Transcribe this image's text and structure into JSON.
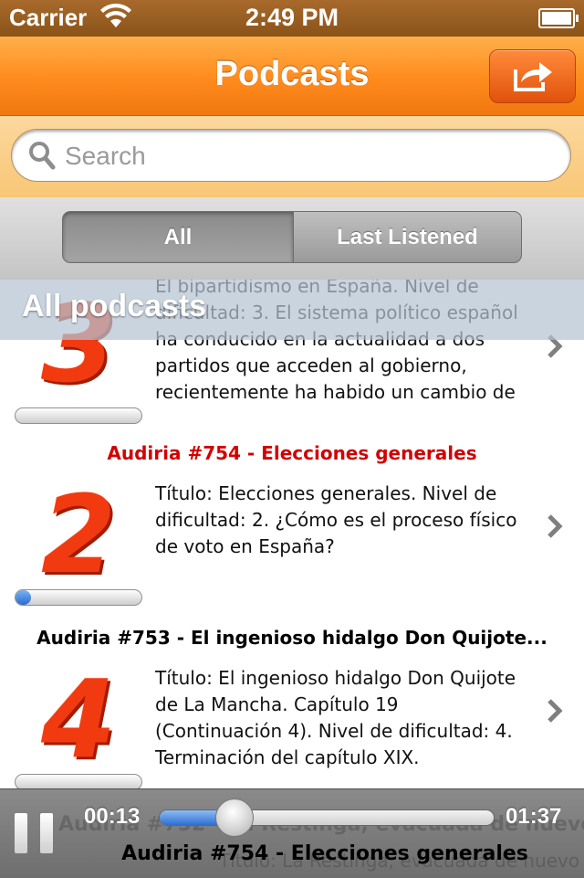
{
  "status_bar": {
    "carrier": "Carrier",
    "time": "2:49 PM"
  },
  "navbar": {
    "title": "Podcasts",
    "share_icon": "share-arrow-icon",
    "accent": "#ff8a1c"
  },
  "search": {
    "placeholder": "Search"
  },
  "segments": {
    "all": "All",
    "last_listened": "Last Listened",
    "selected": "All"
  },
  "section_header": "All podcasts",
  "podcasts": [
    {
      "title": "",
      "level": "3",
      "description": "El bipartidismo en España. Nivel de dificultad: 3. El sistema político español ha conducido en la actualidad a dos partidos que acceden al gobierno, recientemente ha habido un cambio de",
      "progress": 0
    },
    {
      "title": "Audiria #754 - Elecciones generales",
      "title_color": "#d40000",
      "level": "2",
      "description": "Título: Elecciones generales. Nivel de dificultad: 2. ¿Cómo es el proceso físico de voto en España?",
      "progress": 0.12
    },
    {
      "title": "Audiria #753 - El ingenioso hidalgo Don Quijote...",
      "level": "4",
      "description": "Título: El ingenioso hidalgo Don Quijote de La Mancha. Capítulo 19 (Continuación 4). Nivel de dificultad: 4. Terminación del capítulo XIX.",
      "progress": 0
    }
  ],
  "player": {
    "elapsed": "00:13",
    "total": "01:37",
    "position": 0.17,
    "now_playing": "Audiria #754 - Elecciones generales",
    "ghost_title": "Audiria #752 - La Restinga, evacuada de nuevo",
    "ghost_desc": "Título: La Restinga, evacuada de nuevo"
  }
}
